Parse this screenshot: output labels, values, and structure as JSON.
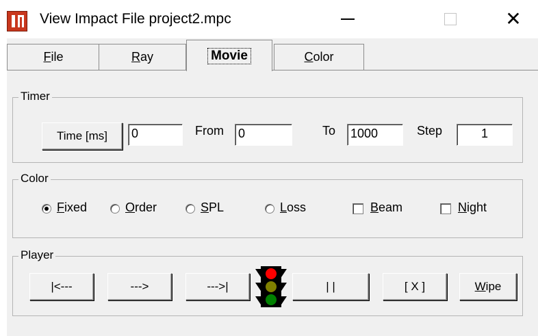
{
  "window": {
    "title": "View Impact File project2.mpc",
    "minimize": "—",
    "close": "✕"
  },
  "tabs": [
    {
      "label": "File",
      "accel": "F",
      "rest": "ile"
    },
    {
      "label": "Ray",
      "accel": "R",
      "rest": "ay"
    },
    {
      "label": "Movie",
      "active": true
    },
    {
      "label": "Color",
      "accel": "C",
      "rest": "olor"
    }
  ],
  "timer": {
    "group_title": "Timer",
    "time_button": "Time [ms]",
    "time_value": "0",
    "from_label": "From",
    "from_value": "0",
    "to_label": "To",
    "to_value": "1000",
    "step_label": "Step",
    "step_value": "1"
  },
  "color": {
    "group_title": "Color",
    "options": [
      {
        "label": "Fixed",
        "accel": "F",
        "rest": "ixed",
        "checked": true
      },
      {
        "label": "Order",
        "accel": "O",
        "rest": "rder",
        "checked": false
      },
      {
        "label": "SPL",
        "accel": "S",
        "rest": "PL",
        "checked": false
      },
      {
        "label": "Loss",
        "accel": "L",
        "rest": "oss",
        "checked": false
      }
    ],
    "checkboxes": [
      {
        "label": "Beam",
        "accel": "B",
        "rest": "eam",
        "checked": false
      },
      {
        "label": "Night",
        "accel": "N",
        "rest": "ight",
        "checked": false
      }
    ]
  },
  "player": {
    "group_title": "Player",
    "buttons": {
      "rewind": "|<---",
      "play": "--->",
      "end": "--->|",
      "pause": "| |",
      "stop": "[ X ]",
      "wipe_accel": "W",
      "wipe_rest": "ipe"
    },
    "traffic_light_colors": {
      "red": "#ff0000",
      "amber": "#808000",
      "green": "#008000",
      "body": "#000000"
    }
  },
  "colors": {
    "accent_icon": "#c8371d"
  }
}
